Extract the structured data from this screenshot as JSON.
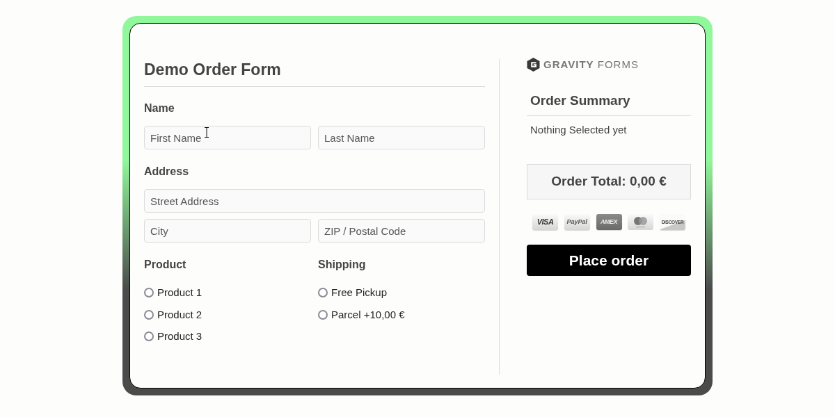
{
  "form": {
    "title": "Demo Order Form",
    "name": {
      "label": "Name",
      "rows": [
        [
          {
            "placeholder": "First Name"
          },
          {
            "placeholder": "Last Name"
          }
        ]
      ]
    },
    "address": {
      "label": "Address",
      "rows": [
        [
          {
            "placeholder": "Street Address"
          }
        ],
        [
          {
            "placeholder": "City"
          },
          {
            "placeholder": "ZIP / Postal Code"
          }
        ]
      ]
    },
    "choices": [
      {
        "label": "Product",
        "options": [
          {
            "label": "Product 1",
            "selected": false
          },
          {
            "label": "Product 2",
            "selected": false
          },
          {
            "label": "Product 3",
            "selected": false
          }
        ]
      },
      {
        "label": "Shipping",
        "options": [
          {
            "label": "Free Pickup",
            "selected": false
          },
          {
            "label": "Parcel +10,00 €",
            "selected": false
          }
        ]
      }
    ]
  },
  "sidebar": {
    "logo": "**GRAVITY** FORMS",
    "title": "Order Summary",
    "empty_text": "Nothing Selected yet",
    "total": "Order Total: 0,00 €",
    "payment_methods": [
      {
        "kind": "visa",
        "label": "VISA"
      },
      {
        "kind": "paypal",
        "label": "PayPal"
      },
      {
        "kind": "amex",
        "label": "AMEX"
      },
      {
        "kind": "mastercard"
      },
      {
        "kind": "discover",
        "label": "DISCOVER"
      }
    ],
    "button": "Place order"
  }
}
